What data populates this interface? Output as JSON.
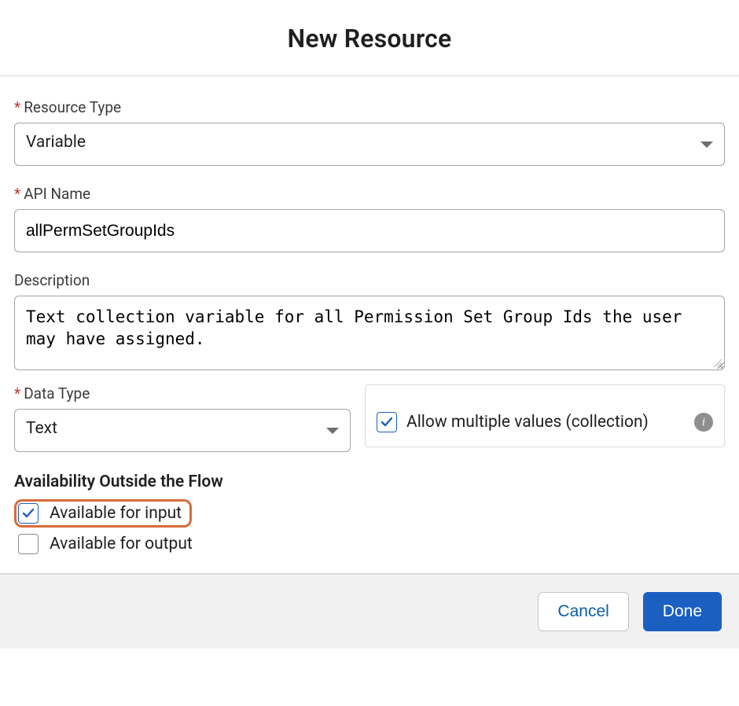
{
  "header": {
    "title": "New Resource"
  },
  "labels": {
    "resourceType": "Resource Type",
    "apiName": "API Name",
    "description": "Description",
    "dataType": "Data Type",
    "availabilitySection": "Availability Outside the Flow"
  },
  "values": {
    "resourceType": "Variable",
    "apiName": "allPermSetGroupIds",
    "description": "Text collection variable for all Permission Set Group Ids the user may have assigned.",
    "dataType": "Text"
  },
  "checkboxes": {
    "allowMultiple": {
      "label": "Allow multiple values (collection)",
      "checked": true
    },
    "availableInput": {
      "label": "Available for input",
      "checked": true
    },
    "availableOutput": {
      "label": "Available for output",
      "checked": false
    }
  },
  "footer": {
    "cancel": "Cancel",
    "done": "Done"
  }
}
